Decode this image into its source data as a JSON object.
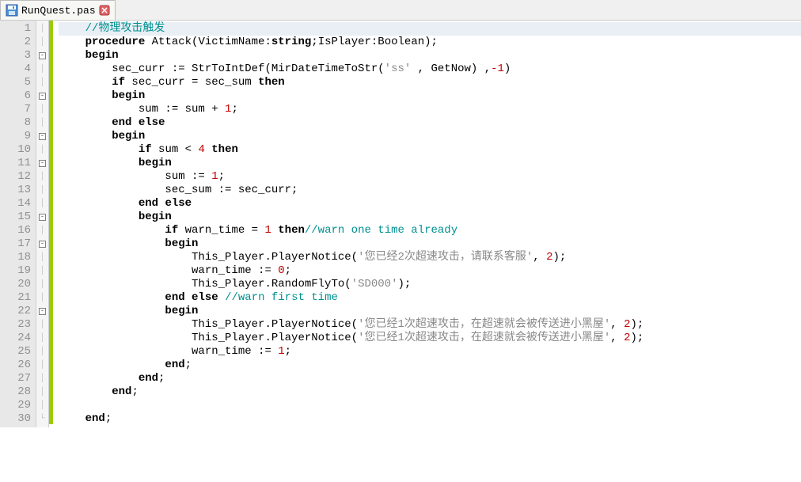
{
  "tab": {
    "filename": "RunQuest.pas"
  },
  "code": {
    "lines": [
      {
        "n": 1,
        "change": true,
        "fold": "|",
        "t": [
          {
            "c": "    ",
            "k": "pl"
          },
          {
            "c": "//物理攻击触发",
            "k": "cm"
          }
        ],
        "current": true
      },
      {
        "n": 2,
        "change": true,
        "fold": "|",
        "t": [
          {
            "c": "    ",
            "k": "pl"
          },
          {
            "c": "procedure",
            "k": "kw"
          },
          {
            "c": " Attack(VictimName:",
            "k": "pl"
          },
          {
            "c": "string",
            "k": "kw"
          },
          {
            "c": ";IsPlayer:Boolean);",
            "k": "pl"
          }
        ]
      },
      {
        "n": 3,
        "change": true,
        "fold": "box",
        "t": [
          {
            "c": "    ",
            "k": "pl"
          },
          {
            "c": "begin",
            "k": "kw"
          }
        ]
      },
      {
        "n": 4,
        "change": true,
        "fold": "|",
        "t": [
          {
            "c": "        sec_curr := StrToIntDef(MirDateTimeToStr(",
            "k": "pl"
          },
          {
            "c": "'ss'",
            "k": "str"
          },
          {
            "c": " , GetNow) ,",
            "k": "pl"
          },
          {
            "c": "-1",
            "k": "num"
          },
          {
            "c": ")",
            "k": "pl"
          }
        ]
      },
      {
        "n": 5,
        "change": true,
        "fold": "|",
        "t": [
          {
            "c": "        ",
            "k": "pl"
          },
          {
            "c": "if",
            "k": "kw"
          },
          {
            "c": " sec_curr = sec_sum ",
            "k": "pl"
          },
          {
            "c": "then",
            "k": "kw"
          }
        ]
      },
      {
        "n": 6,
        "change": true,
        "fold": "box",
        "t": [
          {
            "c": "        ",
            "k": "pl"
          },
          {
            "c": "begin",
            "k": "kw"
          }
        ]
      },
      {
        "n": 7,
        "change": true,
        "fold": "|",
        "t": [
          {
            "c": "            sum := sum + ",
            "k": "pl"
          },
          {
            "c": "1",
            "k": "num"
          },
          {
            "c": ";",
            "k": "pl"
          }
        ]
      },
      {
        "n": 8,
        "change": true,
        "fold": "|",
        "t": [
          {
            "c": "        ",
            "k": "pl"
          },
          {
            "c": "end",
            "k": "kw"
          },
          {
            "c": " ",
            "k": "pl"
          },
          {
            "c": "else",
            "k": "kw"
          }
        ]
      },
      {
        "n": 9,
        "change": true,
        "fold": "box",
        "t": [
          {
            "c": "        ",
            "k": "pl"
          },
          {
            "c": "begin",
            "k": "kw"
          }
        ]
      },
      {
        "n": 10,
        "change": true,
        "fold": "|",
        "t": [
          {
            "c": "            ",
            "k": "pl"
          },
          {
            "c": "if",
            "k": "kw"
          },
          {
            "c": " sum < ",
            "k": "pl"
          },
          {
            "c": "4",
            "k": "num"
          },
          {
            "c": " ",
            "k": "pl"
          },
          {
            "c": "then",
            "k": "kw"
          }
        ]
      },
      {
        "n": 11,
        "change": true,
        "fold": "box",
        "t": [
          {
            "c": "            ",
            "k": "pl"
          },
          {
            "c": "begin",
            "k": "kw"
          }
        ]
      },
      {
        "n": 12,
        "change": true,
        "fold": "|",
        "t": [
          {
            "c": "                sum := ",
            "k": "pl"
          },
          {
            "c": "1",
            "k": "num"
          },
          {
            "c": ";",
            "k": "pl"
          }
        ]
      },
      {
        "n": 13,
        "change": true,
        "fold": "|",
        "t": [
          {
            "c": "                sec_sum := sec_curr;",
            "k": "pl"
          }
        ]
      },
      {
        "n": 14,
        "change": true,
        "fold": "|",
        "t": [
          {
            "c": "            ",
            "k": "pl"
          },
          {
            "c": "end",
            "k": "kw"
          },
          {
            "c": " ",
            "k": "pl"
          },
          {
            "c": "else",
            "k": "kw"
          }
        ]
      },
      {
        "n": 15,
        "change": true,
        "fold": "box",
        "t": [
          {
            "c": "            ",
            "k": "pl"
          },
          {
            "c": "begin",
            "k": "kw"
          }
        ]
      },
      {
        "n": 16,
        "change": true,
        "fold": "|",
        "t": [
          {
            "c": "                ",
            "k": "pl"
          },
          {
            "c": "if",
            "k": "kw"
          },
          {
            "c": " warn_time = ",
            "k": "pl"
          },
          {
            "c": "1",
            "k": "num"
          },
          {
            "c": " ",
            "k": "pl"
          },
          {
            "c": "then",
            "k": "kw"
          },
          {
            "c": "//warn one time already",
            "k": "cm"
          }
        ]
      },
      {
        "n": 17,
        "change": true,
        "fold": "box",
        "t": [
          {
            "c": "                ",
            "k": "pl"
          },
          {
            "c": "begin",
            "k": "kw"
          }
        ]
      },
      {
        "n": 18,
        "change": true,
        "fold": "|",
        "t": [
          {
            "c": "                    This_Player.PlayerNotice(",
            "k": "pl"
          },
          {
            "c": "'您已经2次超速攻击，请联系客服'",
            "k": "str"
          },
          {
            "c": ", ",
            "k": "pl"
          },
          {
            "c": "2",
            "k": "num"
          },
          {
            "c": ");",
            "k": "pl"
          }
        ]
      },
      {
        "n": 19,
        "change": true,
        "fold": "|",
        "t": [
          {
            "c": "                    warn_time := ",
            "k": "pl"
          },
          {
            "c": "0",
            "k": "num"
          },
          {
            "c": ";",
            "k": "pl"
          }
        ]
      },
      {
        "n": 20,
        "change": true,
        "fold": "|",
        "t": [
          {
            "c": "                    This_Player.RandomFlyTo(",
            "k": "pl"
          },
          {
            "c": "'SD000'",
            "k": "str"
          },
          {
            "c": ");",
            "k": "pl"
          }
        ]
      },
      {
        "n": 21,
        "change": true,
        "fold": "|",
        "t": [
          {
            "c": "                ",
            "k": "pl"
          },
          {
            "c": "end",
            "k": "kw"
          },
          {
            "c": " ",
            "k": "pl"
          },
          {
            "c": "else",
            "k": "kw"
          },
          {
            "c": " ",
            "k": "pl"
          },
          {
            "c": "//warn first time",
            "k": "cm"
          }
        ]
      },
      {
        "n": 22,
        "change": true,
        "fold": "box",
        "t": [
          {
            "c": "                ",
            "k": "pl"
          },
          {
            "c": "begin",
            "k": "kw"
          }
        ]
      },
      {
        "n": 23,
        "change": true,
        "fold": "|",
        "t": [
          {
            "c": "                    This_Player.PlayerNotice(",
            "k": "pl"
          },
          {
            "c": "'您已经1次超速攻击，在超速就会被传送进小黑屋'",
            "k": "str"
          },
          {
            "c": ", ",
            "k": "pl"
          },
          {
            "c": "2",
            "k": "num"
          },
          {
            "c": ");",
            "k": "pl"
          }
        ]
      },
      {
        "n": 24,
        "change": true,
        "fold": "|",
        "t": [
          {
            "c": "                    This_Player.PlayerNotice(",
            "k": "pl"
          },
          {
            "c": "'您已经1次超速攻击，在超速就会被传送进小黑屋'",
            "k": "str"
          },
          {
            "c": ", ",
            "k": "pl"
          },
          {
            "c": "2",
            "k": "num"
          },
          {
            "c": ");",
            "k": "pl"
          }
        ]
      },
      {
        "n": 25,
        "change": true,
        "fold": "|",
        "t": [
          {
            "c": "                    warn_time := ",
            "k": "pl"
          },
          {
            "c": "1",
            "k": "num"
          },
          {
            "c": ";",
            "k": "pl"
          }
        ]
      },
      {
        "n": 26,
        "change": true,
        "fold": "|",
        "t": [
          {
            "c": "                ",
            "k": "pl"
          },
          {
            "c": "end",
            "k": "kw"
          },
          {
            "c": ";",
            "k": "pl"
          }
        ]
      },
      {
        "n": 27,
        "change": true,
        "fold": "|",
        "t": [
          {
            "c": "            ",
            "k": "pl"
          },
          {
            "c": "end",
            "k": "kw"
          },
          {
            "c": ";",
            "k": "pl"
          }
        ]
      },
      {
        "n": 28,
        "change": true,
        "fold": "|",
        "t": [
          {
            "c": "        ",
            "k": "pl"
          },
          {
            "c": "end",
            "k": "kw"
          },
          {
            "c": ";",
            "k": "pl"
          }
        ]
      },
      {
        "n": 29,
        "change": true,
        "fold": "|",
        "t": [
          {
            "c": "",
            "k": "pl"
          }
        ]
      },
      {
        "n": 30,
        "change": true,
        "fold": "end",
        "t": [
          {
            "c": "    ",
            "k": "pl"
          },
          {
            "c": "end",
            "k": "kw"
          },
          {
            "c": ";",
            "k": "pl"
          }
        ]
      }
    ]
  }
}
